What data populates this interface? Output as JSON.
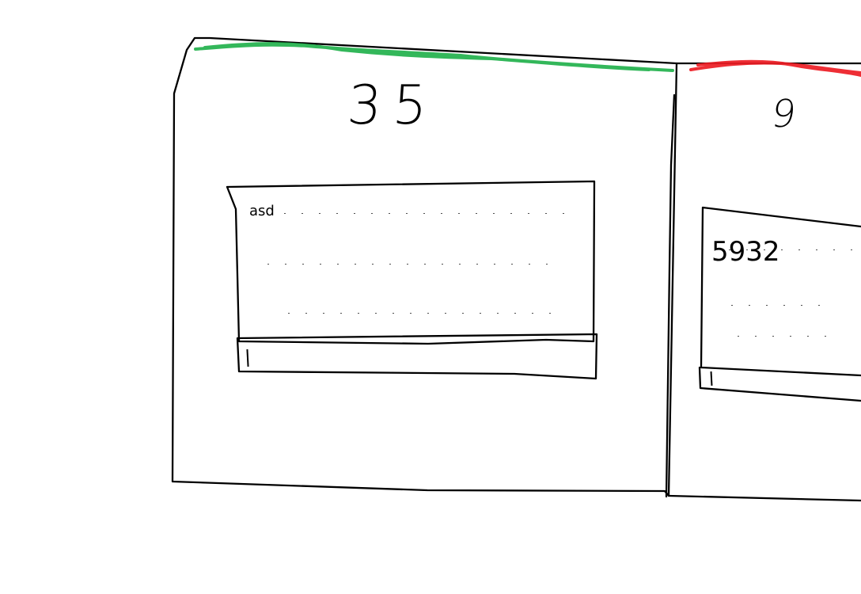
{
  "cards": [
    {
      "value": "35",
      "status_color": "#22b14c",
      "feed": {
        "lines": [
          "asd",
          "",
          ""
        ]
      },
      "input": {
        "value": "",
        "placeholder": ""
      }
    },
    {
      "value": "9",
      "status_color": "#ed1c24",
      "feed": {
        "lines": [
          "5932",
          "",
          ""
        ]
      },
      "input": {
        "value": "",
        "placeholder": ""
      }
    }
  ]
}
